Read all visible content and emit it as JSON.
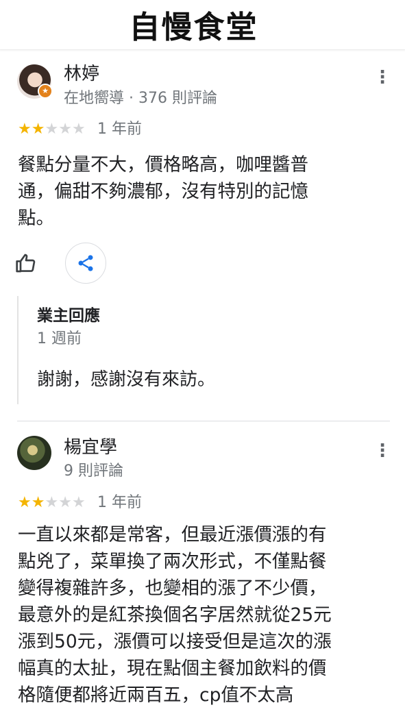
{
  "header": {
    "title": "自慢食堂"
  },
  "reviews": [
    {
      "author": "林婷",
      "meta": "在地嚮導 · 376 則評論",
      "rating": 2,
      "max_rating": 5,
      "time": "1 年前",
      "text": [
        "餐點分量不大，價格略高，咖哩醬普",
        "通，偏甜不夠濃郁，沒有特別的記憶",
        "點。"
      ],
      "reply": {
        "title": "業主回應",
        "time": "1 週前",
        "text": "謝謝，感謝沒有來訪。"
      }
    },
    {
      "author": "楊宜學",
      "meta": "9 則評論",
      "rating": 2,
      "max_rating": 5,
      "time": "1 年前",
      "text": [
        "一直以來都是常客，但最近漲價漲的有",
        "點兇了，菜單換了兩次形式，不僅點餐",
        "變得複雜許多，也變相的漲了不少價，",
        "最意外的是紅茶換個名字居然就從25元",
        "漲到50元，漲價可以接受但是這次的漲",
        "幅真的太扯，現在點個主餐加飲料的價",
        "格隨便都將近兩百五，cp值不太高"
      ]
    }
  ],
  "icons": {
    "more": "more-vert-icon",
    "like": "thumb-up-icon",
    "share": "share-icon",
    "badge": "local-guide-star-icon"
  },
  "colors": {
    "star_on": "#f4b400",
    "star_off": "#d3d4d6",
    "secondary_text": "#70757a"
  }
}
